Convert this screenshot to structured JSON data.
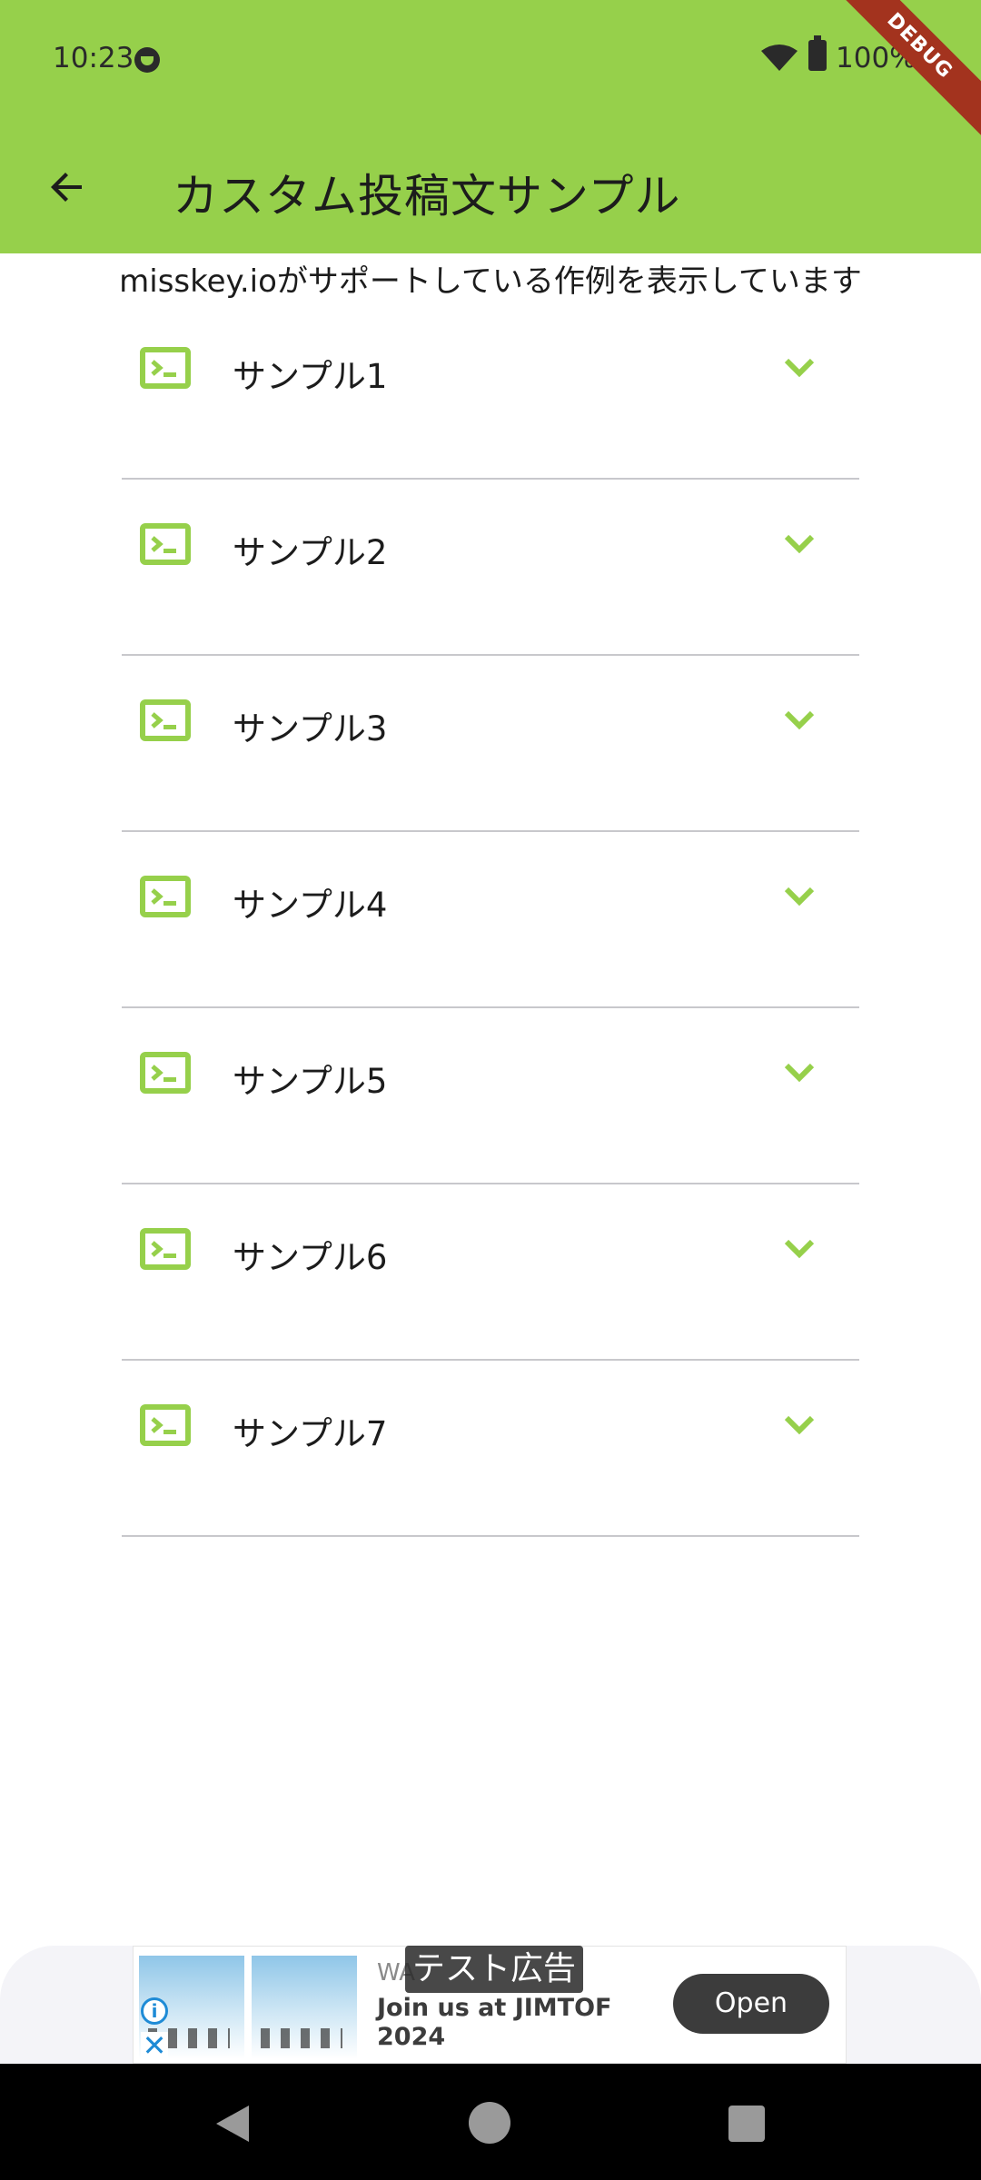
{
  "status_bar": {
    "time": "10:23",
    "battery": "100%"
  },
  "debug_banner": "DEBUG",
  "app_bar": {
    "title": "カスタム投稿文サンプル"
  },
  "subtitle": "misskey.ioがサポートしている作例を表示しています",
  "samples": [
    {
      "label": "サンプル1"
    },
    {
      "label": "サンプル2"
    },
    {
      "label": "サンプル3"
    },
    {
      "label": "サンプル4"
    },
    {
      "label": "サンプル5"
    },
    {
      "label": "サンプル6"
    },
    {
      "label": "サンプル7"
    }
  ],
  "ad": {
    "badge": "テスト広告",
    "advertiser": "WA",
    "headline": "Join us at JIMTOF 2024",
    "open_label": "Open"
  },
  "colors": {
    "accent": "#96d04b",
    "debug": "#a3331e"
  },
  "icons": {
    "back": "arrow-back-icon",
    "item": "terminal-icon",
    "expand": "chevron-down-icon"
  }
}
